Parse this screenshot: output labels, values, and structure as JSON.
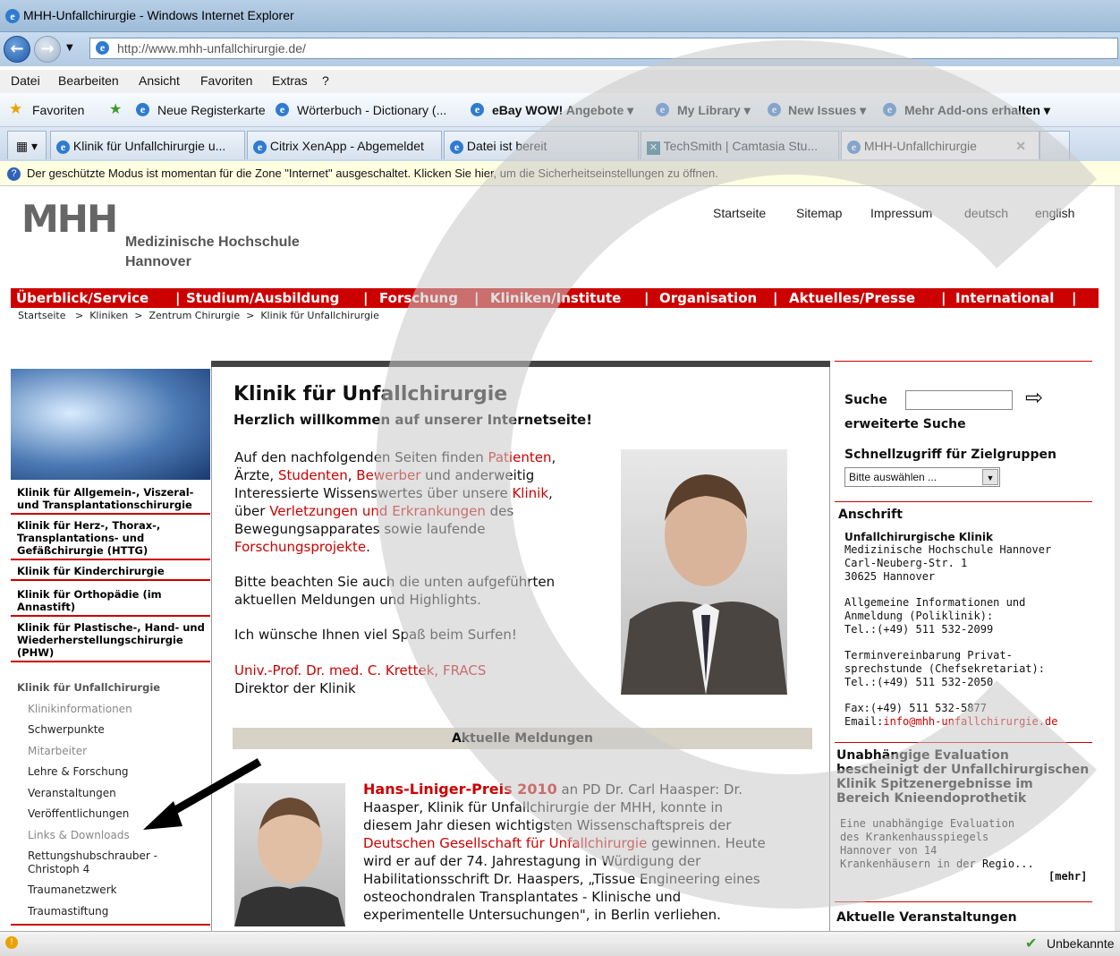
{
  "window": {
    "title": "MHH-Unfallchirurgie - Windows Internet Explorer"
  },
  "address": {
    "url": "http://www.mhh-unfallchirurgie.de/"
  },
  "menu": [
    "Datei",
    "Bearbeiten",
    "Ansicht",
    "Favoriten",
    "Extras",
    "?"
  ],
  "favorites": {
    "label": "Favoriten",
    "items": [
      "Neue Registerkarte",
      "Wörterbuch - Dictionary (...",
      "eBay WOW! Angebote ▾",
      "My Library ▾",
      "New Issues ▾",
      "Mehr Add-ons erhalten ▾"
    ]
  },
  "tabs": [
    "Klinik für Unfallchirurgie u...",
    "Citrix XenApp - Abgemeldet",
    "Datei ist bereit",
    "TechSmith | Camtasia Stu...",
    "MHH-Unfallchirurgie"
  ],
  "infobar": "Der geschützte Modus ist momentan für die Zone \"Internet\" ausgeschaltet. Klicken Sie hier, um die Sicherheitseinstellungen zu öffnen.",
  "header": {
    "logo": "MHH",
    "org_line1": "Medizinische Hochschule",
    "org_line2": "Hannover",
    "links": [
      "Startseite",
      "Sitemap",
      "Impressum",
      "deutsch",
      "english"
    ]
  },
  "mainnav": [
    "Überblick/Service",
    "Studium/Ausbildung",
    "Forschung",
    "Kliniken/Institute",
    "Organisation",
    "Aktuelles/Presse",
    "International"
  ],
  "breadcrumb": "Startseite   >  Kliniken  >  Zentrum Chirurgie  >  Klinik für Unfallchirurgie",
  "leftnav": {
    "clinics": [
      "Klinik für Allgemein-, Viszeral- und Transplantationschirurgie",
      "Klinik für Herz-, Thorax-, Transplantations- und Gefäßchirurgie (HTTG)",
      "Klinik für Kinderchirurgie",
      "Klinik für Orthopädie (im Annastift)",
      "Klinik für Plastische-, Hand- und Wiederherstellungschirurgie (PHW)",
      "Klinik für Unfallchirurgie"
    ],
    "sub": [
      "Klinikinformationen",
      "Schwerpunkte",
      "Mitarbeiter",
      "Lehre & Forschung",
      "Veranstaltungen",
      "Veröffentlichungen",
      "Links & Downloads",
      "Rettungshubschrauber - Christoph 4",
      "Traumanetzwerk",
      "Traumastiftung"
    ]
  },
  "main": {
    "title": "Klinik für Unfallchirurgie",
    "welcome": "Herzlich willkommen auf unserer Internetseite!",
    "p1": {
      "t1": "Auf den nachfolgenden Seiten finden ",
      "patienten": "Patienten",
      "t2": ",",
      "t3": "Ärzte, ",
      "studenten": "Studenten",
      "t4": ", ",
      "bewerber": "Bewerber",
      "t5": " und anderweitig",
      "t6": "Interessierte Wissenswertes über unsere ",
      "klinik": "Klinik",
      "t7": ",",
      "t8": "über ",
      "verletzungen": "Verletzungen und Erkrankungen",
      "t9": " des",
      "t10": "Bewegungsapparates sowie laufende",
      "forschung": "Forschungsprojekte",
      "t11": "."
    },
    "p2a": "Bitte beachten Sie auch die unten aufgeführten",
    "p2b": "aktuellen Meldungen und Highlights.",
    "p3": "Ich wünsche Ihnen viel Spaß beim Surfen!",
    "sig_name": "Univ.-Prof. Dr. med. C. Krettek, FRACS",
    "sig_role": "Direktor der Klinik",
    "news_head": "Aktuelle Meldungen",
    "news": {
      "title": "Hans-Liniger-Preis 2010",
      "l1": " an PD Dr. Carl Haasper: Dr.",
      "l2": "Haasper, Klinik für Unfallchirurgie der MHH, konnte in",
      "l3": "diesem Jahr diesen wichtigsten Wissenschaftspreis der",
      "dgu": "Deutschen Gesellschaft für Unfallchirurgie",
      "l4": " gewinnen. Heute",
      "l5": "wird er auf der 74. Jahrestagung in Würdigung der",
      "l6": "Habilitationsschrift Dr. Haaspers, „Tissue Engineering eines",
      "l7": "osteochondralen Transplantates - Klinische und",
      "l8": "experimentelle Untersuchungen\", in Berlin verliehen."
    }
  },
  "sidebar": {
    "search_label": "Suche",
    "adv_search": "erweiterte Suche",
    "quick_label": "Schnellzugriff für Zielgruppen",
    "quick_select": "Bitte auswählen ...",
    "addr_head": "Anschrift",
    "addr_name": "Unfallchirurgische Klinik",
    "addr_lines": [
      "Medizinische Hochschule Hannover",
      "Carl-Neuberg-Str. 1",
      "30625 Hannover"
    ],
    "info_lines": [
      "Allgemeine Informationen und",
      "Anmeldung (Poliklinik):",
      "Tel.:(+49) 511 532-2099"
    ],
    "term_lines": [
      "Terminvereinbarung Privat-",
      "sprechstunde (Chefsekretariat):",
      "Tel.:(+49) 511 532-2050"
    ],
    "fax": "Fax:(+49) 511 532-5877",
    "email_label": "Email:",
    "email": "info@mhh-unfallchirurgie.de",
    "eval_head": [
      "Unabhängige Evaluation",
      "bescheinigt der Unfallchirurgischen",
      "Klinik Spitzenergebnisse im",
      "Bereich Knieendoprothetik"
    ],
    "eval_text": [
      "Eine unabhängige Evaluation",
      "des Krankenhausspiegels",
      "Hannover von 14",
      "Krankenhäusern in der Regio..."
    ],
    "more": "[mehr]",
    "events_head": "Aktuelle Veranstaltungen"
  },
  "status": {
    "zone": "Unbekannte"
  }
}
